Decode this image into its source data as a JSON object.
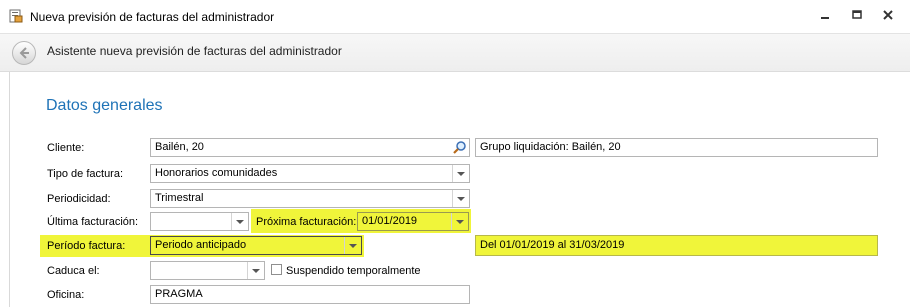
{
  "window": {
    "title": "Nueva previsión de facturas del administrador"
  },
  "wizard": {
    "title": "Asistente nueva previsión de facturas del administrador"
  },
  "section": {
    "title": "Datos generales"
  },
  "form": {
    "cliente": {
      "label": "Cliente:",
      "value": "Bailén, 20",
      "group_value": "Grupo liquidación: Bailén, 20"
    },
    "tipo_factura": {
      "label": "Tipo de factura:",
      "value": "Honorarios comunidades"
    },
    "periodicidad": {
      "label": "Periodicidad:",
      "value": "Trimestral"
    },
    "ultima_facturacion": {
      "label": "Última facturación:",
      "value": ""
    },
    "proxima_facturacion": {
      "label": "Próxima facturación:",
      "value": "01/01/2019"
    },
    "periodo_factura": {
      "label": "Período factura:",
      "value": "Periodo anticipado",
      "range_text": "Del 01/01/2019 al 31/03/2019"
    },
    "caduca": {
      "label": "Caduca el:",
      "value": ""
    },
    "suspendido": {
      "label": "Suspendido temporalmente",
      "checked": false
    },
    "oficina": {
      "label": "Oficina:",
      "value": "PRAGMA"
    }
  },
  "colors": {
    "highlight": "#f0f53a",
    "section_title": "#1f73b7"
  },
  "icons": [
    "app-icon",
    "minimize-icon",
    "restore-icon",
    "close-icon",
    "back-arrow-icon",
    "search-icon",
    "chevron-down-icon"
  ]
}
